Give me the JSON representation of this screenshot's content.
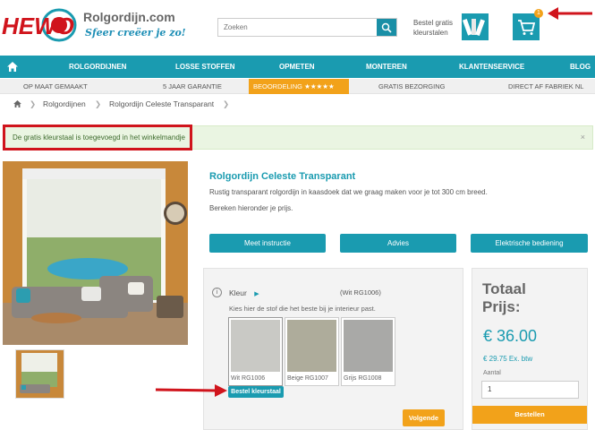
{
  "header": {
    "logo_text": "HEWO",
    "site_name": "Rolgordijn.com",
    "tagline": "Sfeer creëer je zo!",
    "search_placeholder": "Zoeken",
    "sample_label_1": "Bestel gratis",
    "sample_label_2": "kleurstalen",
    "cart_count": "1"
  },
  "nav": {
    "items": [
      "ROLGORDIJNEN",
      "LOSSE STOFFEN",
      "OPMETEN",
      "MONTEREN",
      "KLANTENSERVICE",
      "BLOG"
    ]
  },
  "usp": {
    "items": [
      "OP MAAT GEMAAKT",
      "5 JAAR GARANTIE",
      "BEOORDELING ★★★★★",
      "GRATIS BEZORGING",
      "DIRECT AF FABRIEK NL"
    ]
  },
  "breadcrumb": [
    "Rolgordijnen",
    "Rolgordijn Celeste Transparant"
  ],
  "notice": {
    "text": "De gratis kleurstaal is toegevoegd in het winkelmandje",
    "close": "×"
  },
  "product": {
    "title": "Rolgordijn Celeste Transparant",
    "description": "Rustig transparant rolgordijn in kaasdoek dat we graag maken voor je tot 300 cm breed.",
    "calc_text": "Bereken hieronder je prijs.",
    "buttons": [
      "Meet instructie",
      "Advies",
      "Elektrische bediening"
    ]
  },
  "colour": {
    "label": "Kleur",
    "selected": "(Wit RG1006)",
    "help": "Kies hier de stof die het beste bij je interieur past.",
    "swatches": [
      {
        "name": "Wit RG1006",
        "color": "#c9c9c5"
      },
      {
        "name": "Beige RG1007",
        "color": "#aeac9b"
      },
      {
        "name": "Grijs RG1008",
        "color": "#a9a9a7"
      }
    ],
    "order_sample": "Bestel kleurstaal",
    "next": "Volgende"
  },
  "price": {
    "label": "Totaal Prijs:",
    "amount": "€ 36.00",
    "ex_btw": "€ 29.75 Ex. btw",
    "qty_label": "Aantal",
    "qty_value": "1",
    "order_button": "Bestellen"
  },
  "colors": {
    "primary": "#1a9bb0",
    "accent": "#f2a21a",
    "alert_red": "#d0141c"
  }
}
